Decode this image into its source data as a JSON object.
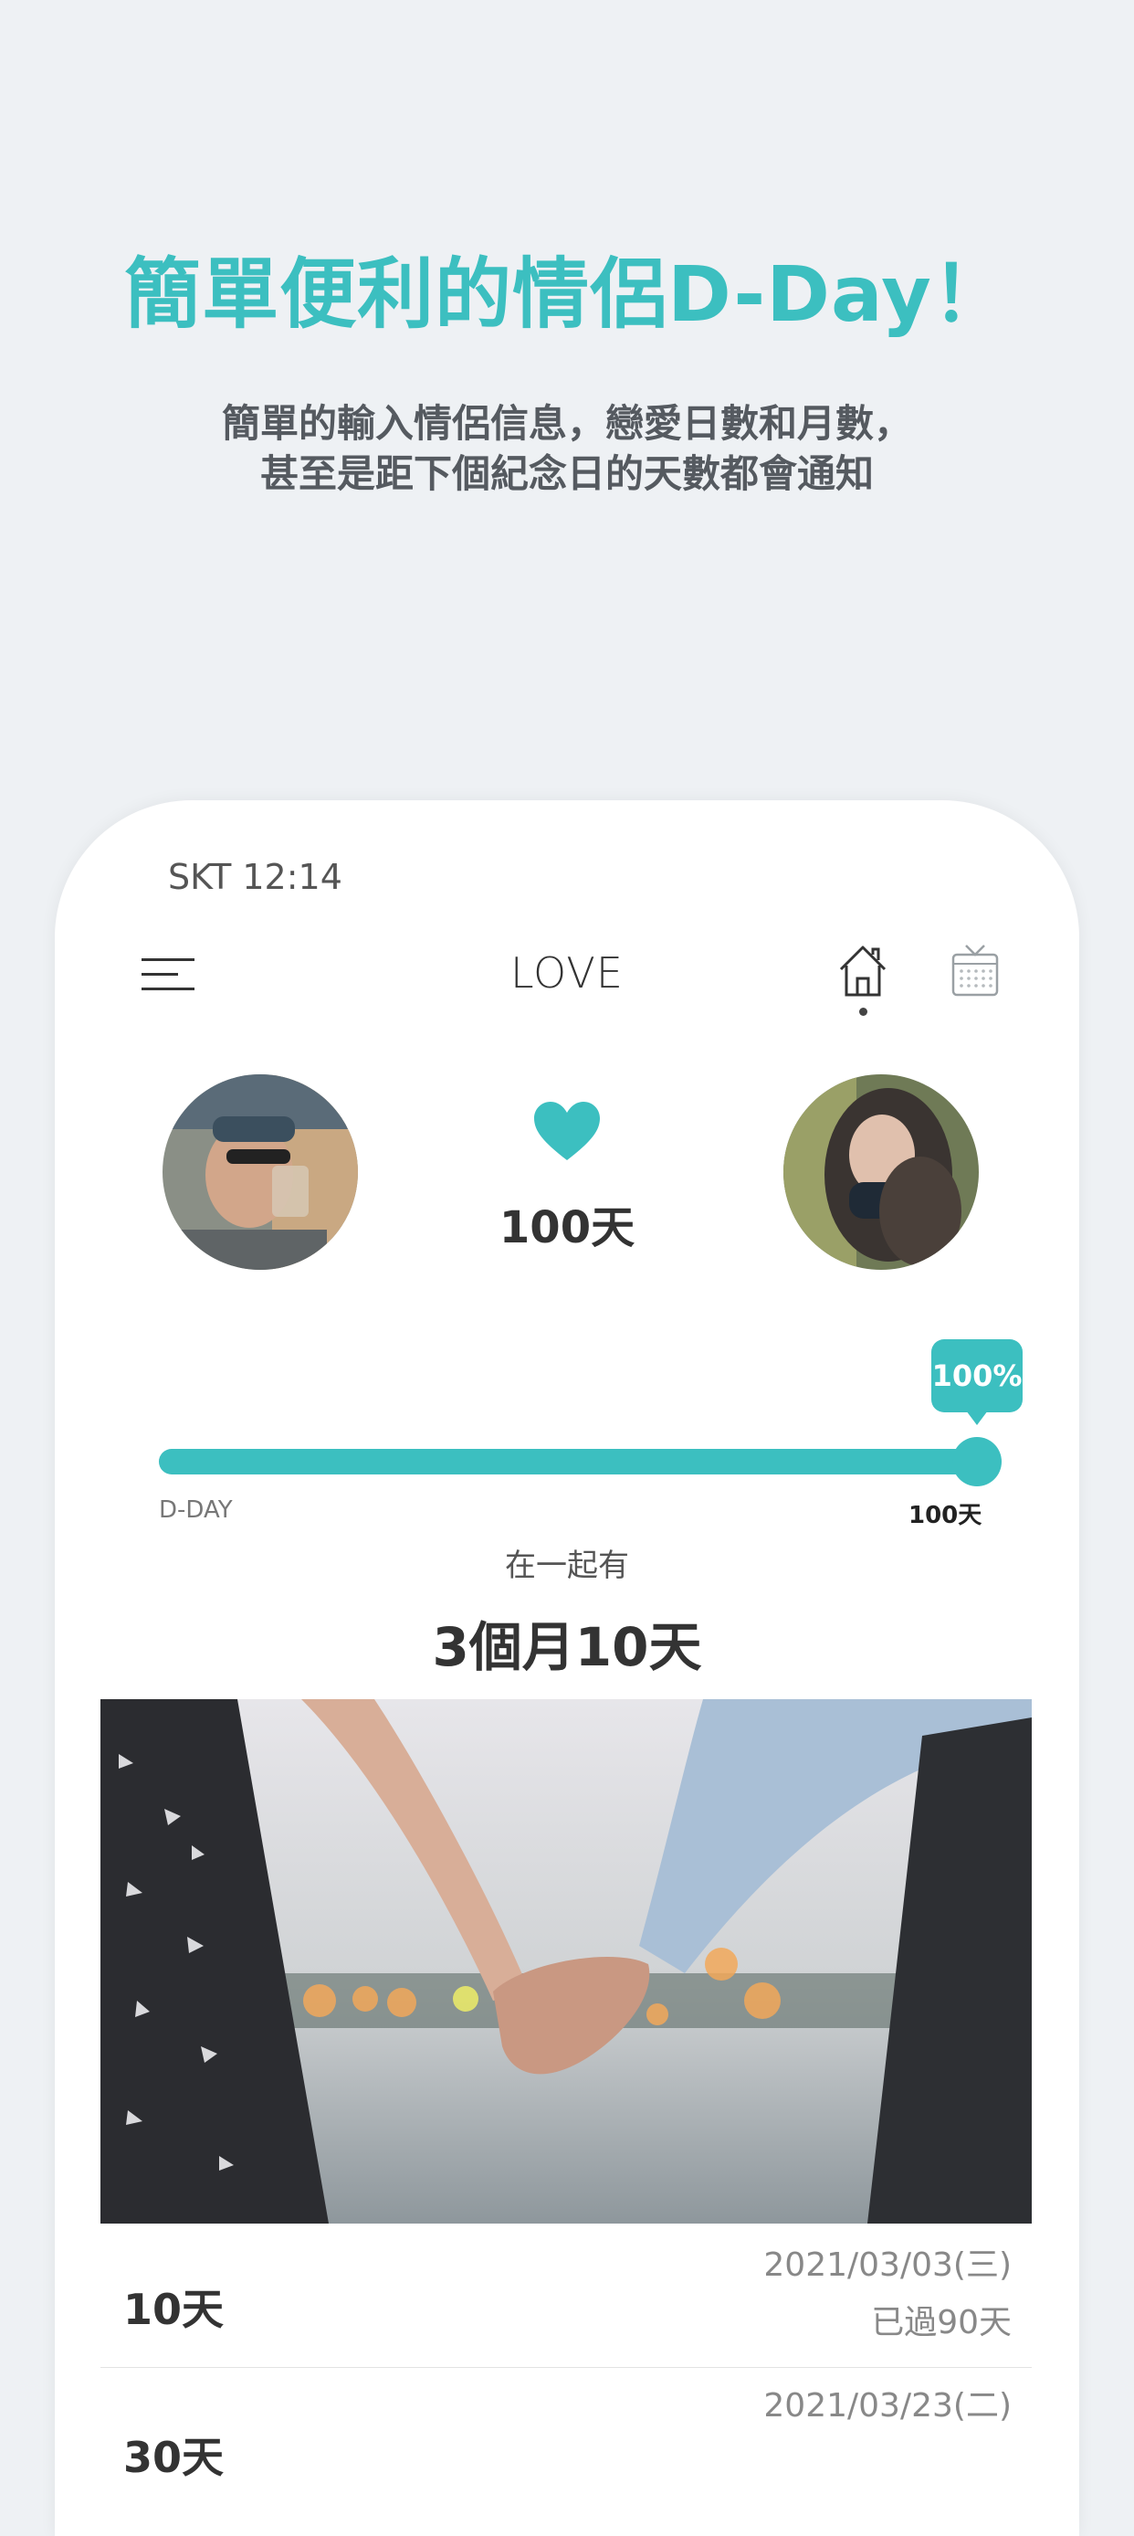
{
  "headline": "簡單便利的情侶D-Day！",
  "subtitle_line1": "簡單的輸入情侶信息，戀愛日數和月數，",
  "subtitle_line2": "甚至是距下個紀念日的天數都會通知",
  "status_bar": {
    "text": "SKT 12:14"
  },
  "header": {
    "title": "LOVE"
  },
  "couple": {
    "days_label": "100天"
  },
  "progress": {
    "badge": "100%",
    "start_label": "D-DAY",
    "end_label": "100天",
    "value": 1.0
  },
  "together": {
    "label": "在一起有",
    "value": "3個月10天"
  },
  "anniversaries": [
    {
      "title": "10天",
      "date": "2021/03/03(三)",
      "since": "已過90天"
    },
    {
      "title": "30天",
      "date": "2021/03/23(二)"
    }
  ],
  "colors": {
    "accent": "#3cbfc0",
    "background": "#eef1f4",
    "text": "#333333"
  },
  "icons": [
    "menu-icon",
    "home-icon",
    "calendar-icon",
    "heart-icon"
  ]
}
